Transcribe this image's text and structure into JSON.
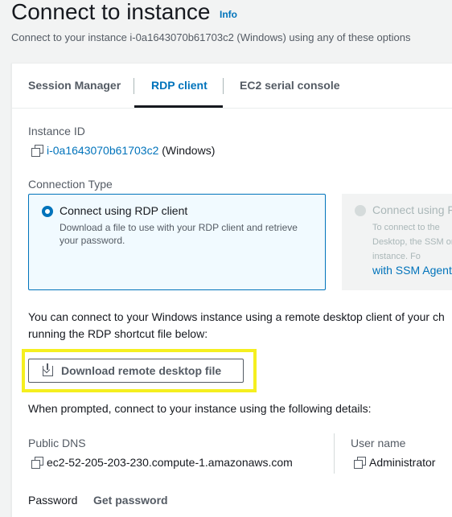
{
  "header": {
    "title": "Connect to instance",
    "info_label": "Info",
    "subtitle": "Connect to your instance i-0a1643070b61703c2 (Windows) using any of these options"
  },
  "tabs": [
    {
      "label": "Session Manager",
      "active": false
    },
    {
      "label": "RDP client",
      "active": true
    },
    {
      "label": "EC2 serial console",
      "active": false
    }
  ],
  "instance": {
    "label": "Instance ID",
    "id": "i-0a1643070b61703c2",
    "platform": "(Windows)"
  },
  "connection_type": {
    "label": "Connection Type",
    "options": [
      {
        "title": "Connect using RDP client",
        "description": "Download a file to use with your RDP client and retrieve your password.",
        "selected": true
      },
      {
        "title": "Connect using F",
        "description": "To connect to the Desktop, the SSM on the instance. Fo",
        "link": "with SSM Agent",
        "selected": false,
        "disabled": true
      }
    ]
  },
  "instructions": "You can connect to your Windows instance using a remote desktop client of your ch running the RDP shortcut file below:",
  "download_button": "Download remote desktop file",
  "prompt_text": "When prompted, connect to your instance using the following details:",
  "details": {
    "public_dns_label": "Public DNS",
    "public_dns": "ec2-52-205-203-230.compute-1.amazonaws.com",
    "username_label": "User name",
    "username": "Administrator",
    "password_label": "Password",
    "get_password": "Get password"
  },
  "colors": {
    "link": "#0073bb",
    "highlight": "#f5ef1f",
    "selected_tile_bg": "#f1faff"
  }
}
